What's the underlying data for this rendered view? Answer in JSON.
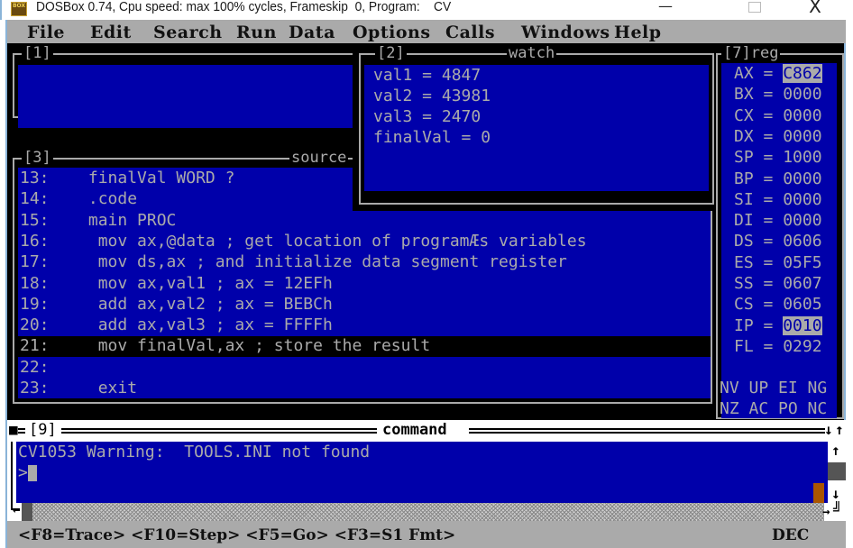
{
  "window": {
    "title": "DOSBox 0.74, Cpu speed: max 100% cycles, Frameskip  0, Program:    CV",
    "icon": "dosbox-icon",
    "icon_text": "BOX",
    "controls": {
      "minimize": "—",
      "maximize": "",
      "close": "X"
    }
  },
  "menu": {
    "items": [
      "File",
      "Edit",
      "Search",
      "Run",
      "Data",
      "Options",
      "Calls",
      "Windows",
      "Help"
    ]
  },
  "panel1": {
    "number": "[1]",
    "title": ""
  },
  "watch": {
    "number": "[2]",
    "title": "watch",
    "lines": [
      "val1 = 4847",
      "val2 = 43981",
      "val3 = 2470",
      "finalVal = 0"
    ]
  },
  "source": {
    "number": "[3]",
    "title": "source",
    "lines": [
      {
        "num": "13:",
        "code": "  finalVal WORD ?"
      },
      {
        "num": "14:",
        "code": "  .code"
      },
      {
        "num": "15:",
        "code": "  main PROC"
      },
      {
        "num": "16:",
        "code": "   mov ax,@data ; get location of programÆs variables"
      },
      {
        "num": "17:",
        "code": "   mov ds,ax ; and initialize data segment register"
      },
      {
        "num": "18:",
        "code": "   mov ax,val1 ; ax = 12EFh"
      },
      {
        "num": "19:",
        "code": "   add ax,val2 ; ax = BEBCh"
      },
      {
        "num": "20:",
        "code": "   add ax,val3 ; ax = FFFFh"
      },
      {
        "num": "21:",
        "code": "   mov finalVal,ax ; store the result"
      },
      {
        "num": "22:",
        "code": ""
      },
      {
        "num": "23:",
        "code": "   exit"
      }
    ],
    "current_line": "21:"
  },
  "registers": {
    "number": "[7]",
    "title": "reg",
    "items": [
      {
        "name": "AX",
        "value": "C862",
        "changed": true
      },
      {
        "name": "BX",
        "value": "0000",
        "changed": false
      },
      {
        "name": "CX",
        "value": "0000",
        "changed": false
      },
      {
        "name": "DX",
        "value": "0000",
        "changed": false
      },
      {
        "name": "SP",
        "value": "1000",
        "changed": false
      },
      {
        "name": "BP",
        "value": "0000",
        "changed": false
      },
      {
        "name": "SI",
        "value": "0000",
        "changed": false
      },
      {
        "name": "DI",
        "value": "0000",
        "changed": false
      },
      {
        "name": "DS",
        "value": "0606",
        "changed": false
      },
      {
        "name": "ES",
        "value": "05F5",
        "changed": false
      },
      {
        "name": "SS",
        "value": "0607",
        "changed": false
      },
      {
        "name": "CS",
        "value": "0605",
        "changed": false
      },
      {
        "name": "IP",
        "value": "0010",
        "changed": true
      },
      {
        "name": "FL",
        "value": "0292",
        "changed": false
      }
    ],
    "flags_row1": "NV UP EI NG",
    "flags_row2": "NZ AC PO NC"
  },
  "command": {
    "number": "[9]",
    "title": "command",
    "lines": [
      "CV1053 Warning:  TOOLS.INI not found"
    ],
    "prompt": ">"
  },
  "statusbar": {
    "keys": "<F8=Trace> <F10=Step> <F5=Go> <F3=S1 Fmt>",
    "mode": "DEC"
  },
  "colors": {
    "background": "#000000",
    "panel_blue": "#0000aa",
    "text_gray": "#aaaaaa",
    "menu_gray": "#aaaaaa",
    "highlight_black": "#000000",
    "cursor_orange": "#aa5500"
  }
}
